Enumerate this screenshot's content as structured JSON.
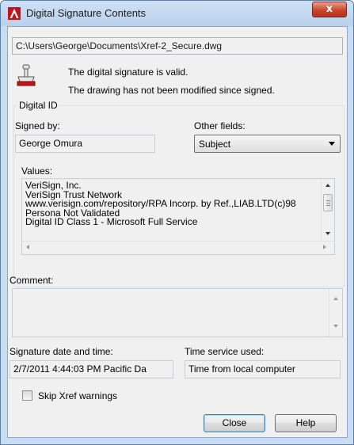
{
  "window": {
    "title": "Digital Signature Contents",
    "close_glyph": "x",
    "accent_color": "#b8331b"
  },
  "file_path": "C:\\Users\\George\\Documents\\Xref-2_Secure.dwg",
  "status": {
    "line1": "The digital signature is valid.",
    "line2": "The drawing has not been modified since signed."
  },
  "digital_id": {
    "legend": "Digital ID",
    "signed_by_label": "Signed by:",
    "signed_by_value": "George Omura",
    "other_fields_label": "Other fields:",
    "other_fields_selected": "Subject",
    "values_label": "Values:",
    "values_lines": [
      "VeriSign, Inc.",
      "VeriSign Trust Network",
      "www.verisign.com/repository/RPA Incorp. by Ref.,LIAB.LTD(c)98",
      "Persona Not Validated",
      "Digital ID Class 1 - Microsoft Full Service"
    ]
  },
  "comment": {
    "label": "Comment:",
    "value": ""
  },
  "signature_date": {
    "label": "Signature date and time:",
    "value": "2/7/2011  4:44:03 PM  Pacific Da"
  },
  "time_service": {
    "label": "Time service used:",
    "value": "Time from local computer"
  },
  "skip_xref": {
    "label": "Skip Xref warnings",
    "checked": false
  },
  "buttons": {
    "close": "Close",
    "help": "Help"
  },
  "icons": {
    "app": "autocad-icon",
    "signature": "signature-stamp-icon"
  }
}
